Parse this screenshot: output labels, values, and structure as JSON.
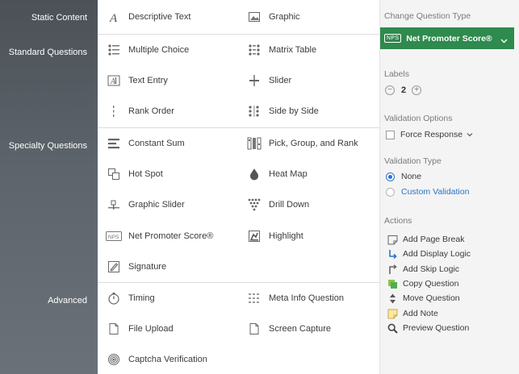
{
  "sidebar": {
    "categories": [
      "Static Content",
      "Standard Questions",
      "Specialty Questions",
      "Advanced"
    ]
  },
  "question_types": {
    "static": [
      {
        "label": "Descriptive Text",
        "icon": "descriptive-text-icon"
      },
      {
        "label": "Graphic",
        "icon": "graphic-icon"
      }
    ],
    "standard": [
      {
        "label": "Multiple Choice",
        "icon": "multiple-choice-icon"
      },
      {
        "label": "Matrix Table",
        "icon": "matrix-table-icon"
      },
      {
        "label": "Text Entry",
        "icon": "text-entry-icon"
      },
      {
        "label": "Slider",
        "icon": "slider-icon"
      },
      {
        "label": "Rank Order",
        "icon": "rank-order-icon"
      },
      {
        "label": "Side by Side",
        "icon": "side-by-side-icon"
      }
    ],
    "specialty": [
      {
        "label": "Constant Sum",
        "icon": "constant-sum-icon"
      },
      {
        "label": "Pick, Group, and Rank",
        "icon": "pick-group-rank-icon"
      },
      {
        "label": "Hot Spot",
        "icon": "hot-spot-icon"
      },
      {
        "label": "Heat Map",
        "icon": "heat-map-icon"
      },
      {
        "label": "Graphic Slider",
        "icon": "graphic-slider-icon"
      },
      {
        "label": "Drill Down",
        "icon": "drill-down-icon"
      },
      {
        "label": "Net Promoter Score®",
        "icon": "nps-icon"
      },
      {
        "label": "Highlight",
        "icon": "highlight-icon"
      },
      {
        "label": "Signature",
        "icon": "signature-icon"
      }
    ],
    "advanced": [
      {
        "label": "Timing",
        "icon": "timing-icon"
      },
      {
        "label": "Meta Info Question",
        "icon": "meta-info-icon"
      },
      {
        "label": "File Upload",
        "icon": "file-upload-icon"
      },
      {
        "label": "Screen Capture",
        "icon": "screen-capture-icon"
      },
      {
        "label": "Captcha Verification",
        "icon": "captcha-icon"
      }
    ]
  },
  "panel": {
    "change_type_heading": "Change Question Type",
    "type_badge": "NPS",
    "selected_type": "Net Promoter Score®",
    "labels_heading": "Labels",
    "labels_minus": "−",
    "labels_value": "2",
    "labels_plus": "+",
    "validation_options_heading": "Validation Options",
    "force_response": "Force Response",
    "validation_type_heading": "Validation Type",
    "validation_none": "None",
    "validation_custom": "Custom Validation",
    "actions_heading": "Actions",
    "actions": [
      {
        "label": "Add Page Break",
        "icon": "page-break-icon"
      },
      {
        "label": "Add Display Logic",
        "icon": "display-logic-icon"
      },
      {
        "label": "Add Skip Logic",
        "icon": "skip-logic-icon"
      },
      {
        "label": "Copy Question",
        "icon": "copy-icon"
      },
      {
        "label": "Move Question",
        "icon": "move-icon"
      },
      {
        "label": "Add Note",
        "icon": "note-icon"
      },
      {
        "label": "Preview Question",
        "icon": "preview-icon"
      }
    ]
  },
  "colors": {
    "sidebar": "#555b61",
    "accent_green": "#2e8a4d",
    "link_blue": "#2b73c8"
  }
}
